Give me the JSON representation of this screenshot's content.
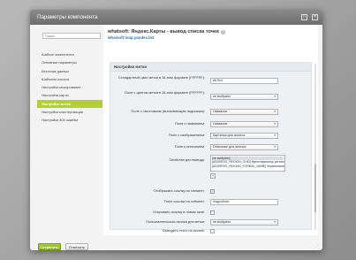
{
  "dialog": {
    "title": "Параметры компонента",
    "close_icon": "close-icon",
    "expand_icon": "expand-icon"
  },
  "sidebar": {
    "search_placeholder": "Поиск",
    "items": [
      {
        "label": "Шаблон компонента",
        "active": false
      },
      {
        "label": "Основные параметры",
        "active": false
      },
      {
        "label": "Источник данных",
        "active": false
      },
      {
        "label": "Шаблоны ссылок",
        "active": false
      },
      {
        "label": "Настройки кеширования",
        "active": false
      },
      {
        "label": "Настройки карты",
        "active": false
      },
      {
        "label": "Настройки метки",
        "active": true
      },
      {
        "label": "Настройки кластеризации",
        "active": false
      },
      {
        "label": "Настройки 404 ошибки",
        "active": false
      }
    ]
  },
  "component": {
    "title": "whatsoft: Яндекс.Карты - вывод списка точек",
    "subtitle": "whatsoft:map.yandex.list"
  },
  "section": {
    "title": "Настройки метки",
    "fields": {
      "std_color_label": "Стандартный цвет метки в 16-ном формате (FFFFFF):",
      "std_color_value": "6b7fc4",
      "field_color_label": "Поле с цветом метки в 16-ном формате (FFFFFF):",
      "field_color_value": "не выбрано",
      "field_title_label": "Поле с заголовком (всплывающая подсказка):",
      "field_title_value": "Название",
      "field_name_label": "Поле с названием:",
      "field_name_value": "Название",
      "field_image_label": "Поле с изображением:",
      "field_image_value": "Картинка для анонса",
      "field_desc_label": "Поле с описанием:",
      "field_desc_value": "Описание для анонса",
      "props_label": "Свойства для вывода:",
      "props_options": [
        "(не выбрано)",
        "[ADDRESS_REGION_GUID] Идентификатор региона (GUID из ФИ",
        "[ADDRESS_REGION_FORMAL_NAME] Формализованное наиме"
      ],
      "plus_label": "+",
      "show_link_label": "Отображать ссылку на элемент:",
      "show_link_checked": true,
      "link_text_label": "Текст ссылки на элемент:",
      "link_text_value": "подробнее",
      "new_window_label": "Открывать ссылку в новом окне:",
      "new_window_checked": false,
      "custom_icon_label": "Пользовательская иконка для метки:",
      "custom_icon_value": "не выбрано",
      "show_text_label": "Выводить текст на иконке:",
      "show_text_checked": false
    }
  },
  "footer": {
    "save_label": "Сохранить",
    "cancel_label": "Отменить"
  }
}
